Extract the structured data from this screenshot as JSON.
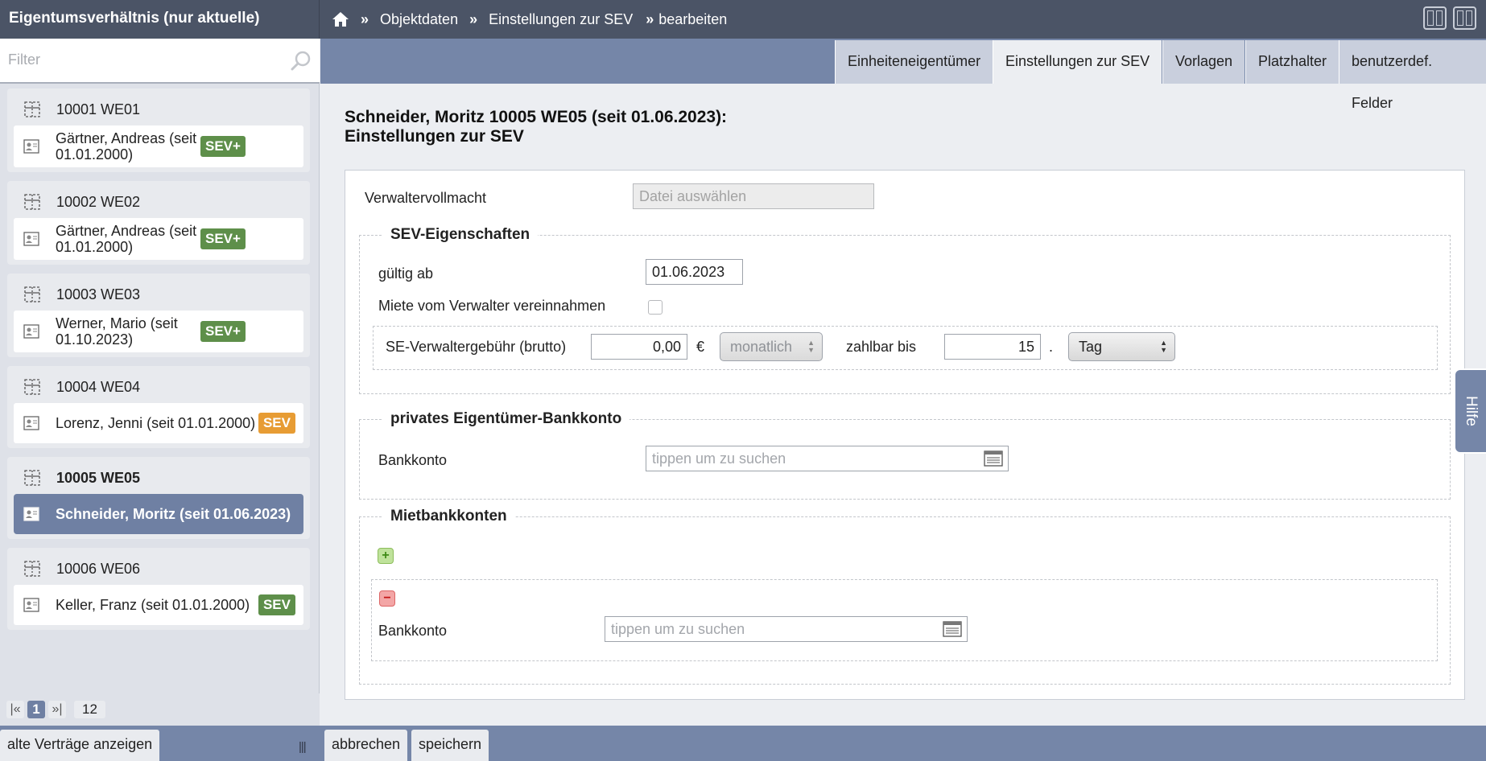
{
  "sidebar": {
    "title": "Eigentumsverhältnis (nur aktuelle)",
    "filter_placeholder": "Filter",
    "units": [
      {
        "unit": "10001 WE01",
        "owner": "Gärtner, Andreas (seit 01.01.2000)",
        "badge": "SEV+",
        "badge_color": "#5e8f4a"
      },
      {
        "unit": "10002 WE02",
        "owner": "Gärtner, Andreas (seit 01.01.2000)",
        "badge": "SEV+",
        "badge_color": "#5e8f4a"
      },
      {
        "unit": "10003 WE03",
        "owner": "Werner, Mario (seit 01.10.2023)",
        "badge": "SEV+",
        "badge_color": "#5e8f4a"
      },
      {
        "unit": "10004 WE04",
        "owner": "Lorenz, Jenni (seit 01.01.2000)",
        "badge": "SEV",
        "badge_color": "#e79c34"
      },
      {
        "unit": "10005 WE05",
        "owner": "Schneider, Moritz (seit 01.06.2023)",
        "badge": "",
        "selected": true
      },
      {
        "unit": "10006 WE06",
        "owner": "Keller, Franz (seit 01.01.2000)",
        "badge": "SEV",
        "badge_color": "#5e8f4a"
      }
    ],
    "pager": {
      "first": "|«",
      "current": "1",
      "last": "»|",
      "total": "12"
    },
    "show_old_button": "alte Verträge anzeigen",
    "grip": "|||"
  },
  "breadcrumb": {
    "sep": "»",
    "items": [
      "Objektdaten",
      "Einstellungen zur SEV",
      "bearbeiten"
    ]
  },
  "tabs": [
    {
      "label": "Einheiteneigentümer",
      "active": false
    },
    {
      "label": "Einstellungen zur SEV",
      "active": true
    },
    {
      "label": "Vorlagen",
      "active": false
    },
    {
      "label": "Platzhalter",
      "active": false
    },
    {
      "label": "benutzerdef. Felder",
      "active": false
    }
  ],
  "page": {
    "title_line1": "Schneider, Moritz 10005 WE05 (seit 01.06.2023):",
    "title_line2": "Einstellungen zur SEV"
  },
  "form": {
    "verwaltervollmacht_label": "Verwaltervollmacht",
    "file_button": "Datei auswählen",
    "sev": {
      "legend": "SEV-Eigenschaften",
      "gueltig_label": "gültig ab",
      "gueltig_value": "01.06.2023",
      "miete_label": "Miete vom Verwalter vereinnahmen",
      "miete_checked": false,
      "fee_label": "SE-Verwaltergebühr (brutto)",
      "fee_value": "0,00",
      "currency": "€",
      "interval": "monatlich",
      "zahlbar_label": "zahlbar bis",
      "zahlbar_value": "15",
      "dot": ".",
      "unit": "Tag"
    },
    "bank": {
      "legend": "privates Eigentümer-Bankkonto",
      "label": "Bankkonto",
      "placeholder": "tippen um zu suchen"
    },
    "miet": {
      "legend": "Mietbankkonten",
      "add": "+",
      "remove": "−",
      "label": "Bankkonto",
      "placeholder": "tippen um zu suchen"
    }
  },
  "buttons": {
    "cancel": "abbrechen",
    "save": "speichern"
  },
  "help": "Hilfe"
}
